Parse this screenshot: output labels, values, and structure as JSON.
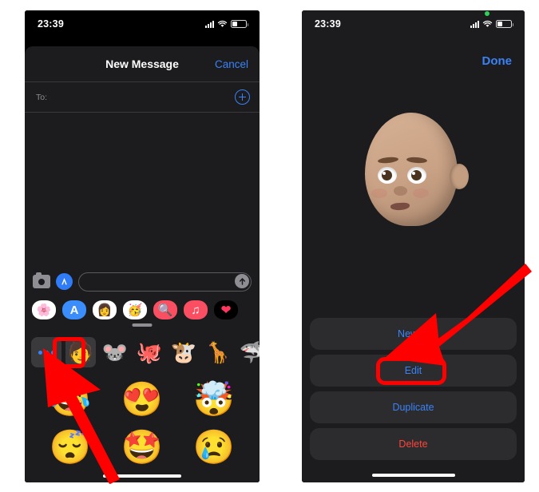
{
  "meta": {
    "accent_blue": "#3a82f7",
    "destructive_red": "#ff453a",
    "annotation_red": "#ff0000",
    "sheet_bg": "#2c2c2e",
    "screen_bg": "#1c1c1e"
  },
  "left_phone": {
    "status_bar": {
      "time": "23:39",
      "signal_icon": "cellular-signal-icon",
      "wifi_icon": "wifi-icon",
      "battery_icon": "battery-icon"
    },
    "navbar": {
      "title": "New Message",
      "cancel_label": "Cancel"
    },
    "recipient_row": {
      "to_label": "To:",
      "add_contact_icon": "add-contact-plus-icon"
    },
    "compose_bar": {
      "camera_icon": "camera-icon",
      "appstore_icon": "app-store-icon",
      "input_value": "",
      "input_placeholder": "",
      "send_icon": "send-arrow-up-icon"
    },
    "app_drawer": [
      {
        "name": "photos-app-icon",
        "glyph": "🌸",
        "bg": "#ffffff"
      },
      {
        "name": "app-store-icon",
        "glyph": "A",
        "bg": "#3a8dfa"
      },
      {
        "name": "memoji-app-icon",
        "glyph": "👩",
        "bg": "#ffffff"
      },
      {
        "name": "memoji-stickers-app-icon",
        "glyph": "🥳",
        "bg": "#ffffff"
      },
      {
        "name": "images-search-app-icon",
        "glyph": "🔍",
        "bg": "#fa4f62"
      },
      {
        "name": "music-app-icon",
        "glyph": "♫",
        "bg": "#fa4f62"
      },
      {
        "name": "digital-touch-app-icon",
        "glyph": "❤",
        "bg": "#000000"
      }
    ],
    "character_row": [
      {
        "name": "more-memoji-button",
        "glyph": "",
        "selected": false,
        "is_more": true
      },
      {
        "name": "memoji-avatar",
        "glyph": "🧑",
        "selected": true,
        "is_more": false
      },
      {
        "name": "mouse-animoji",
        "glyph": "🐭",
        "selected": false,
        "is_more": false
      },
      {
        "name": "octopus-animoji",
        "glyph": "🐙",
        "selected": false,
        "is_more": false
      },
      {
        "name": "cow-animoji",
        "glyph": "🐮",
        "selected": false,
        "is_more": false
      },
      {
        "name": "giraffe-animoji",
        "glyph": "🦒",
        "selected": false,
        "is_more": false
      },
      {
        "name": "shark-animoji",
        "glyph": "🦈",
        "selected": false,
        "is_more": false
      }
    ],
    "sticker_grid": [
      {
        "name": "sticker-laughing-crying",
        "glyph": "😂"
      },
      {
        "name": "sticker-heart-eyes",
        "glyph": "😍"
      },
      {
        "name": "sticker-mind-blown",
        "glyph": "🤯"
      },
      {
        "name": "sticker-sleeping",
        "glyph": "😴"
      },
      {
        "name": "sticker-star-struck",
        "glyph": "🤩"
      },
      {
        "name": "sticker-crying",
        "glyph": "😢"
      }
    ]
  },
  "right_phone": {
    "status_bar": {
      "time": "23:39",
      "recording_dot": "green-recording-indicator",
      "signal_icon": "cellular-signal-icon",
      "wifi_icon": "wifi-icon",
      "battery_icon": "battery-icon"
    },
    "done_label": "Done",
    "memoji_preview_name": "memoji-head-preview",
    "action_sheet": [
      {
        "name": "new-memoji-button",
        "label": "New M",
        "style": "default",
        "highlighted": false
      },
      {
        "name": "edit-memoji-button",
        "label": "Edit",
        "style": "default",
        "highlighted": true
      },
      {
        "name": "duplicate-memoji-button",
        "label": "Duplicate",
        "style": "default",
        "highlighted": false
      },
      {
        "name": "delete-memoji-button",
        "label": "Delete",
        "style": "destructive",
        "highlighted": false
      }
    ]
  },
  "annotations": {
    "left_arrow": "red-arrow-pointing-to-more-button",
    "right_arrow": "red-arrow-pointing-to-edit-button",
    "left_box": "red-highlight-more-button",
    "right_box": "red-highlight-edit-button"
  }
}
